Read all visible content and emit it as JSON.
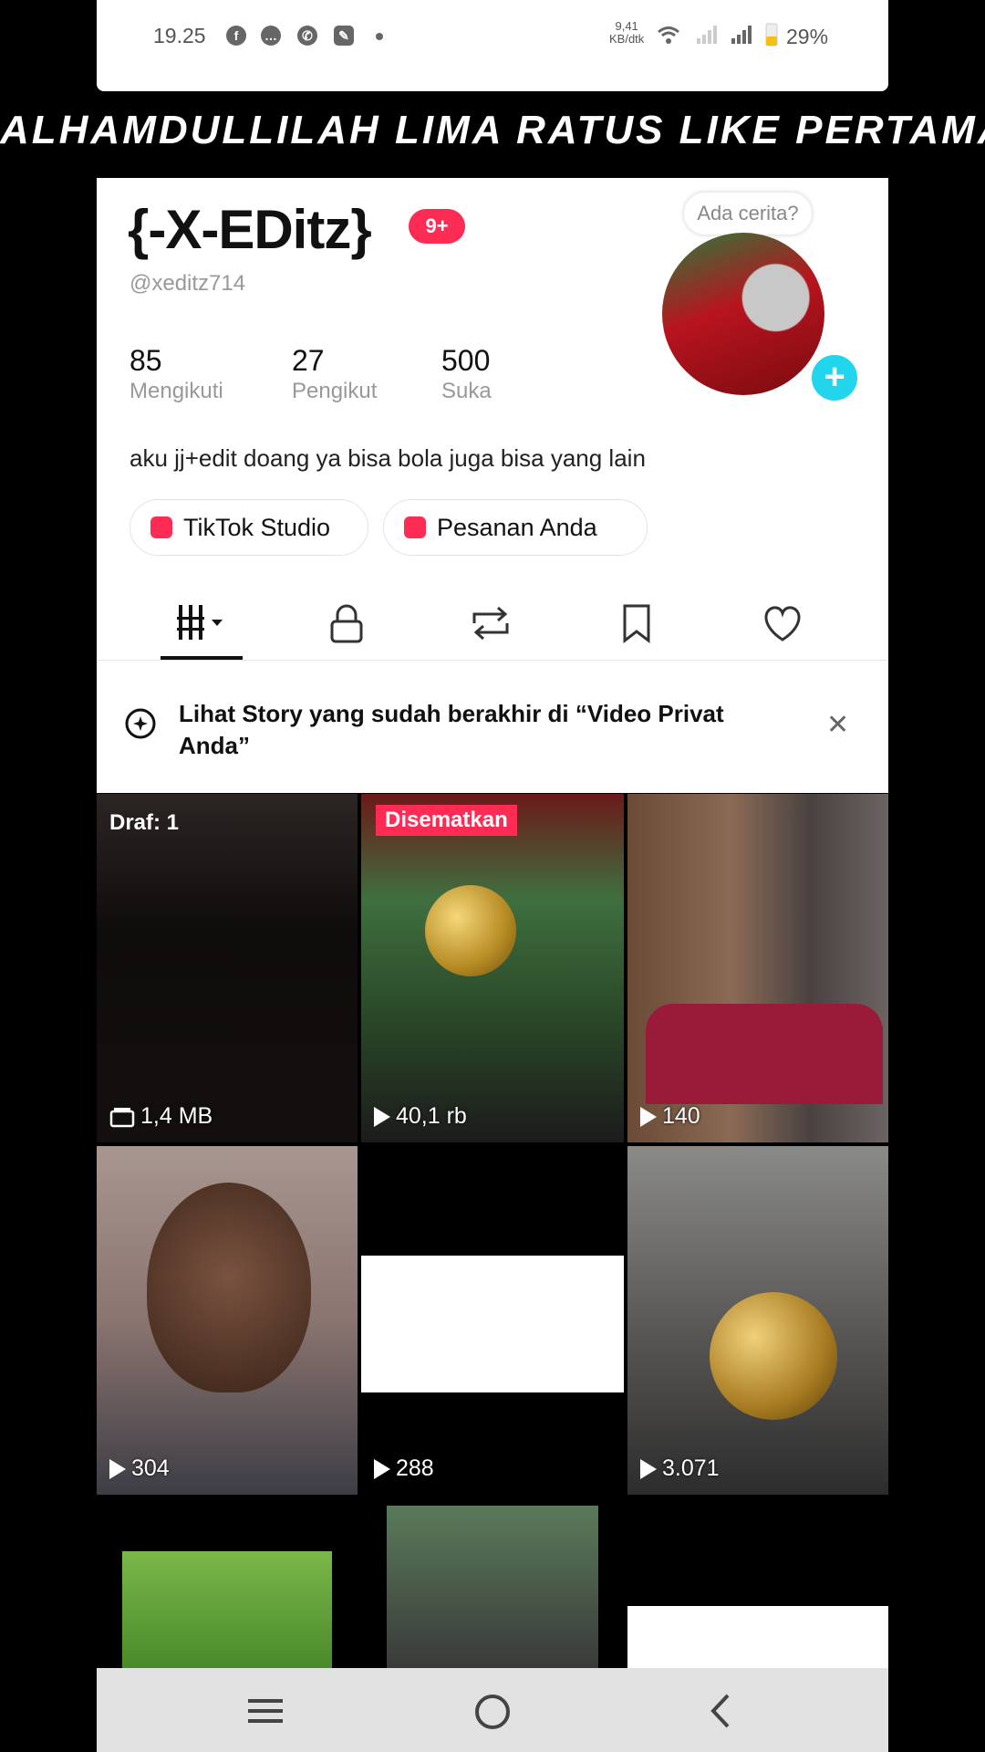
{
  "status_bar": {
    "time": "19.25",
    "network_speed_value": "9,41",
    "network_speed_unit": "KB/dtk",
    "battery_percent": "29%",
    "icons": [
      "facebook-icon",
      "message-icon",
      "whatsapp-icon",
      "app-icon",
      "dot-icon",
      "wifi-icon",
      "signal-icon",
      "signal-icon",
      "battery-icon"
    ]
  },
  "banner_text": "ALHAMDULLILAH LIMA RATUS LIKE PERTAMA",
  "profile": {
    "display_name": "{-X-EDitz}",
    "notification_badge": "9+",
    "username": "@xeditz714",
    "story_bubble": "Ada cerita?",
    "stats": [
      {
        "value": "85",
        "label": "Mengikuti"
      },
      {
        "value": "27",
        "label": "Pengikut"
      },
      {
        "value": "500",
        "label": "Suka"
      }
    ],
    "bio": "aku jj+edit doang ya bisa bola juga bisa yang lain",
    "buttons": {
      "studio": "TikTok Studio",
      "orders": "Pesanan Anda"
    }
  },
  "tabs": [
    "videos-tab",
    "private-tab",
    "reposts-tab",
    "saved-tab",
    "liked-tab"
  ],
  "notice": {
    "text": "Lihat Story yang sudah berakhir di “Video Privat Anda”"
  },
  "grid": {
    "draft_label": "Draf: 1",
    "draft_size": "1,4 MB",
    "pinned_label": "Disematkan",
    "views": [
      "40,1 rb",
      "140",
      "304",
      "288",
      "3.071"
    ]
  },
  "colors": {
    "accent": "#fe2c55",
    "add_button": "#20d5ec"
  }
}
